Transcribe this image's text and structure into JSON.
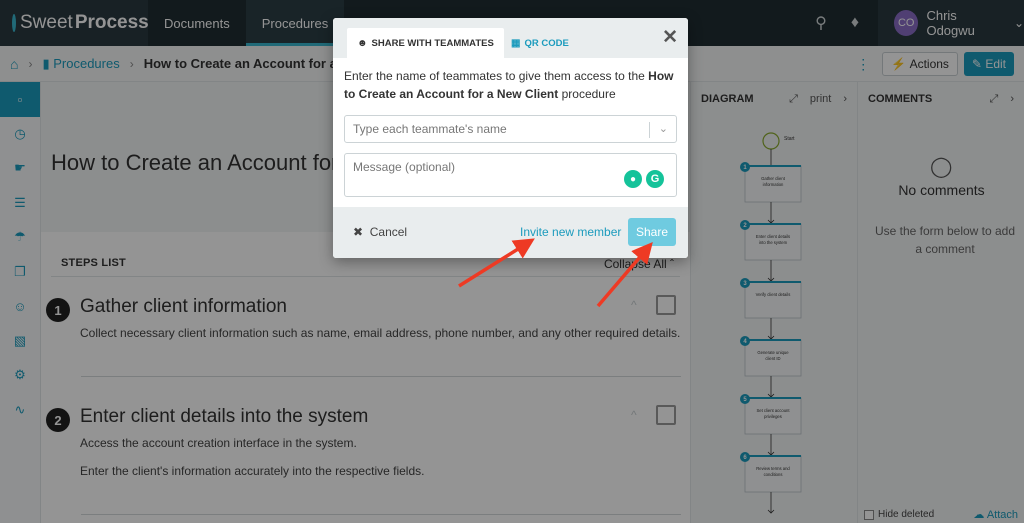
{
  "topnav": {
    "logo_sweet": "Sweet",
    "logo_process": "Process",
    "items": [
      {
        "label": "Documents"
      },
      {
        "label": "Procedures"
      }
    ],
    "user_initials": "CO",
    "user_name": "Chris Odogwu"
  },
  "breadcrumb": {
    "section": "Procedures",
    "current": "How to Create an Account for a New"
  },
  "toolbar": {
    "actions_label": "Actions",
    "edit_label": "Edit"
  },
  "main": {
    "title": "How to Create an Account for",
    "steps_label": "STEPS LIST",
    "collapse_all": "Collapse All",
    "steps": [
      {
        "num": "1",
        "title": "Gather client information",
        "lines": [
          "Collect necessary client information such as name, email address, phone number, and any other required details."
        ]
      },
      {
        "num": "2",
        "title": "Enter client details into the system",
        "lines": [
          "Access the account creation interface in the system.",
          "Enter the client's information accurately into the respective fields."
        ]
      }
    ]
  },
  "diagram": {
    "title": "DIAGRAM",
    "print": "print",
    "start": "Start",
    "nodes": [
      {
        "num": "1",
        "lines": [
          "Gather client",
          "information"
        ]
      },
      {
        "num": "2",
        "lines": [
          "Enter client details",
          "into the system"
        ]
      },
      {
        "num": "3",
        "lines": [
          "Verify client details"
        ]
      },
      {
        "num": "4",
        "lines": [
          "Generate unique",
          "client ID"
        ]
      },
      {
        "num": "5",
        "lines": [
          "Set client account",
          "privileges"
        ]
      },
      {
        "num": "6",
        "lines": [
          "Review terms and",
          "conditions"
        ]
      }
    ]
  },
  "comments": {
    "title": "COMMENTS",
    "empty": "No comments",
    "hint": "Use the form below to add a comment",
    "hide_deleted": "Hide deleted",
    "attach": "Attach"
  },
  "modal": {
    "tab_share": "SHARE WITH TEAMMATES",
    "tab_qr": "QR CODE",
    "instruction_prefix": "Enter the name of teammates to give them access to the ",
    "instruction_procedure": "How to Create an Account for a New Client",
    "instruction_suffix": " procedure",
    "teammate_placeholder": "Type each teammate's name",
    "message_placeholder": "Message (optional)",
    "cancel": "Cancel",
    "invite": "Invite new member",
    "share": "Share"
  },
  "colors": {
    "accent": "#1b9bbd",
    "nav_bg": "#1f2d33",
    "annotation_arrow": "#ee3a24",
    "share_button": "#6fcbe0"
  }
}
